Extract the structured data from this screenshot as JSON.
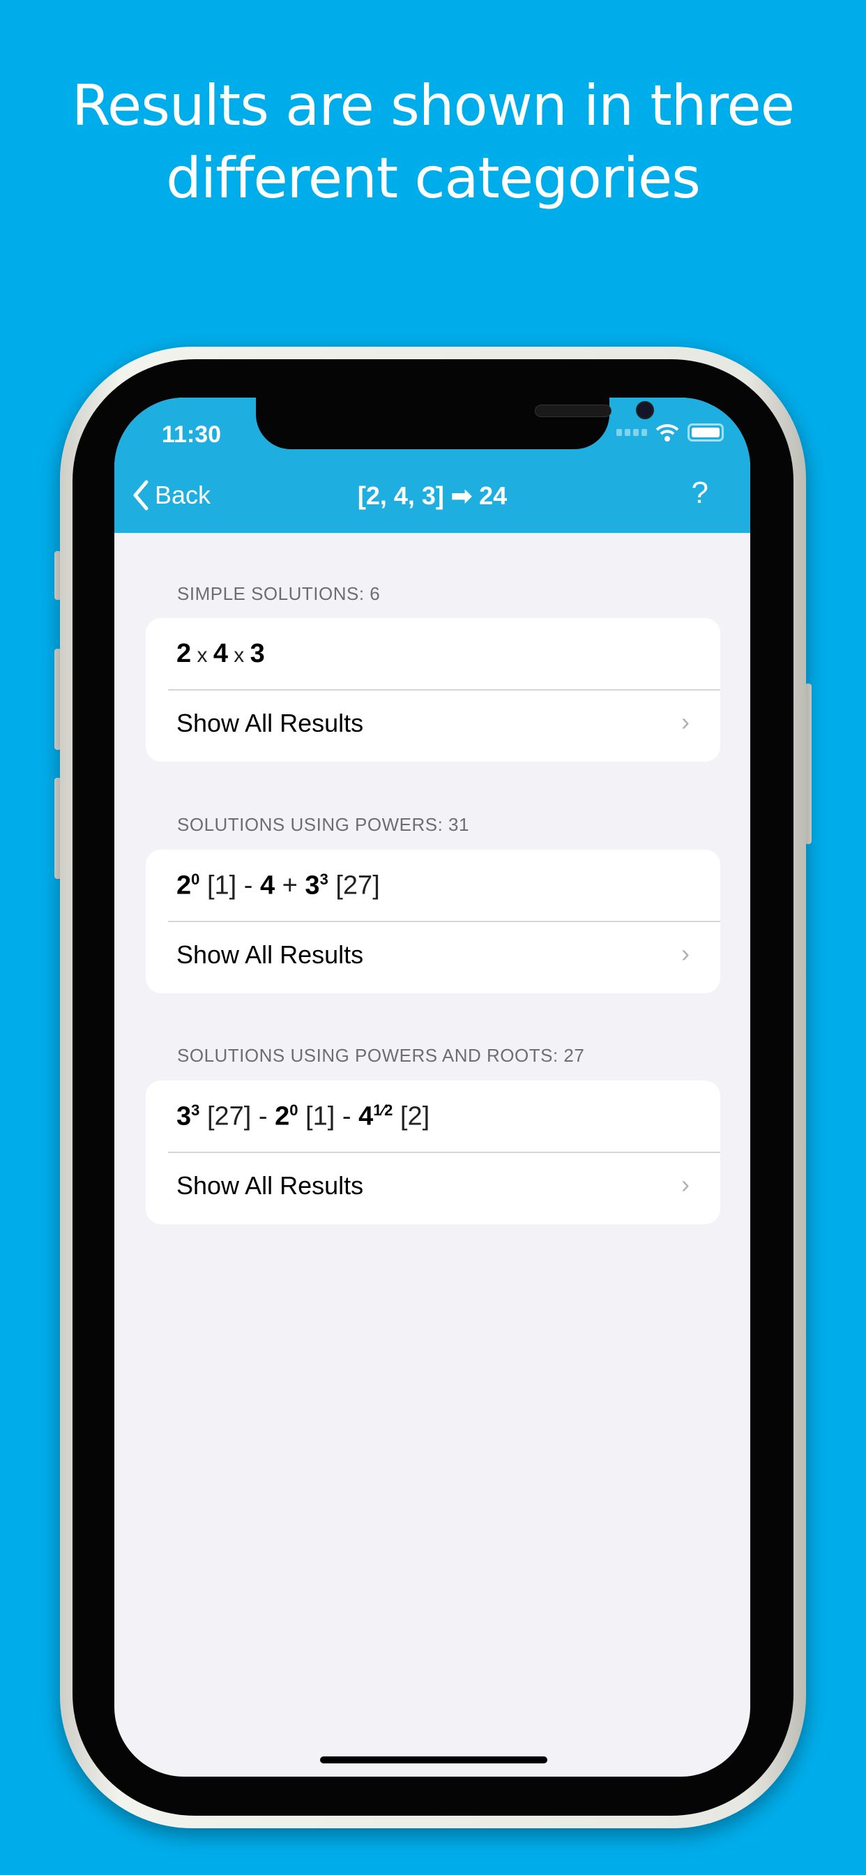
{
  "headline": {
    "line1": "Results are shown in three",
    "line2": "different categories"
  },
  "status": {
    "time": "11:30"
  },
  "nav": {
    "back_label": "Back",
    "title": "[2, 4, 3] ➡ 24",
    "help_label": "?"
  },
  "sections": [
    {
      "header": "SIMPLE SOLUTIONS: 6",
      "show_all": "Show All Results"
    },
    {
      "header": "SOLUTIONS USING POWERS: 31",
      "show_all": "Show All Results"
    },
    {
      "header": "SOLUTIONS USING POWERS AND ROOTS: 27",
      "show_all": "Show All Results"
    }
  ],
  "expr": {
    "s0": {
      "a": "2",
      "op1": " x ",
      "b": "4",
      "op2": " x ",
      "c": "3"
    },
    "s1": {
      "a": "2",
      "ae": "0",
      "av": " [1] - ",
      "b": "4",
      "op": " + ",
      "c": "3",
      "ce": "3",
      "cv": " [27]"
    },
    "s2": {
      "a": "3",
      "ae": "3",
      "av": " [27] - ",
      "b": "2",
      "be": "0",
      "bv": " [1] - ",
      "c": "4",
      "ce": "1⁄2",
      "cv": " [2]"
    }
  },
  "colors": {
    "background": "#00adeb",
    "nav": "#1eaee0",
    "screen": "#f2f2f7"
  }
}
